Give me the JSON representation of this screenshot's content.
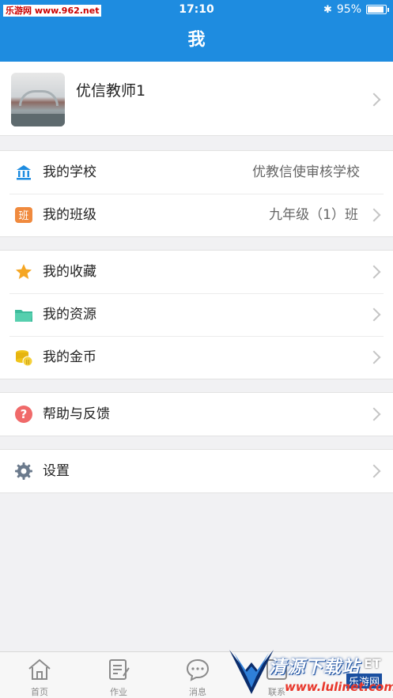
{
  "status": {
    "carrier": "乐游网 www.962.net",
    "time": "17:10",
    "battery": "95%",
    "battery_level": 0.95
  },
  "nav": {
    "title": "我"
  },
  "profile": {
    "name": "优信教师1"
  },
  "groups": [
    {
      "rows": [
        {
          "label": "我的学校",
          "value": "优教信使审核学校",
          "icon": "school-icon"
        },
        {
          "label": "我的班级",
          "value": "九年级（1）班",
          "icon": "class-icon"
        }
      ]
    },
    {
      "rows": [
        {
          "label": "我的收藏",
          "icon": "star-icon"
        },
        {
          "label": "我的资源",
          "icon": "folder-icon"
        },
        {
          "label": "我的金币",
          "icon": "coins-icon"
        }
      ]
    },
    {
      "rows": [
        {
          "label": "帮助与反馈",
          "icon": "help-icon"
        }
      ]
    },
    {
      "rows": [
        {
          "label": "设置",
          "icon": "gear-icon"
        }
      ]
    }
  ],
  "tabs": [
    {
      "label": "首页",
      "icon": "home-icon"
    },
    {
      "label": "作业",
      "icon": "homework-icon"
    },
    {
      "label": "消息",
      "icon": "message-icon"
    },
    {
      "label": "联系",
      "icon": "contacts-icon"
    }
  ],
  "watermark": {
    "title": "清源下载站",
    "url": "www.lulinet.com",
    "tag": "乐游网",
    "net": "ET"
  },
  "colors": {
    "accent": "#1e8ce0",
    "star": "#f5a623",
    "folder": "#3dbb9b",
    "coin": "#f0c419",
    "help": "#f06a6a",
    "gear": "#6b7a8c"
  }
}
